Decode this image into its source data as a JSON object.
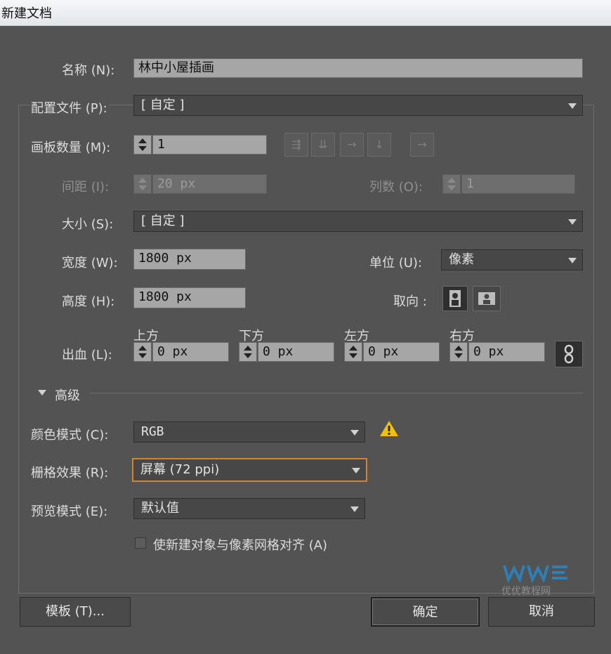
{
  "window": {
    "title": "新建文档"
  },
  "name": {
    "label": "名称 (N):",
    "value": "林中小屋插画"
  },
  "profile": {
    "label": "配置文件 (P):",
    "value": "[ 自定 ]"
  },
  "artboards": {
    "count_label": "画板数量 (M):",
    "count_value": "1",
    "spacing_label": "间距 (I):",
    "spacing_value": "20 px",
    "columns_label": "列数 (O):",
    "columns_value": "1"
  },
  "size": {
    "label": "大小 (S):",
    "value": "[ 自定 ]"
  },
  "width": {
    "label": "宽度 (W):",
    "value": "1800 px"
  },
  "height": {
    "label": "高度 (H):",
    "value": "1800 px"
  },
  "units": {
    "label": "单位 (U):",
    "value": "像素"
  },
  "orientation": {
    "label": "取向 :"
  },
  "bleed": {
    "label": "出血 (L):",
    "top_label": "上方",
    "top_value": "0 px",
    "bottom_label": "下方",
    "bottom_value": "0 px",
    "left_label": "左方",
    "left_value": "0 px",
    "right_label": "右方",
    "right_value": "0 px"
  },
  "advanced": {
    "label": "高级",
    "color_mode_label": "颜色模式 (C):",
    "color_mode_value": "RGB",
    "raster_label": "栅格效果 (R):",
    "raster_value": "屏幕 (72 ppi)",
    "preview_label": "预览模式 (E):",
    "preview_value": "默认值",
    "align_pixel_label": "使新建对象与像素网格对齐 (A)"
  },
  "buttons": {
    "templates": "模板 (T)...",
    "ok": "确定",
    "cancel": "取消"
  },
  "watermark": {
    "text": "优优教程网"
  },
  "colors": {
    "accent": "#d9822b",
    "warning": "#f2c200"
  }
}
